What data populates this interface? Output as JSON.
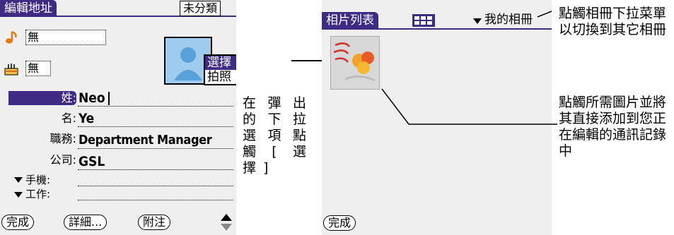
{
  "left_screen": {
    "title": "編輯地址",
    "category": "未分類",
    "ringtone_value": "無",
    "alarm_value": "無",
    "fields": [
      {
        "label": "姓:",
        "value": "Neo"
      },
      {
        "label": "名:",
        "value": "Ye"
      },
      {
        "label": "職務:",
        "value": "Department Manager"
      },
      {
        "label": "公司:",
        "value": "GSL"
      },
      {
        "label": "手機:",
        "value": ""
      },
      {
        "label": "工作:",
        "value": ""
      }
    ],
    "popup_menu": [
      "選擇",
      "拍照"
    ],
    "buttons": {
      "done": "完成",
      "details": "詳細...",
      "note": "附注"
    }
  },
  "left_callout": "在彈出的下拉選項點觸[選擇]",
  "right_screen": {
    "title": "相片列表",
    "album_dropdown": "我的相冊",
    "done_button": "完成"
  },
  "right_callout_top": "點觸相冊下拉菜單以切換到其它相冊",
  "right_callout_bottom": "點觸所需圖片並將其直接添加到您正在編輯的通訊記錄中",
  "colors": {
    "accent": "#3f2a84",
    "screen_bg": "#efefef"
  },
  "icons": [
    "music-note-icon",
    "birthday-cake-icon",
    "contact-photo-icon",
    "thumbnail-view-icon",
    "dropdown-triangle-icon",
    "scroll-arrows-icon"
  ]
}
